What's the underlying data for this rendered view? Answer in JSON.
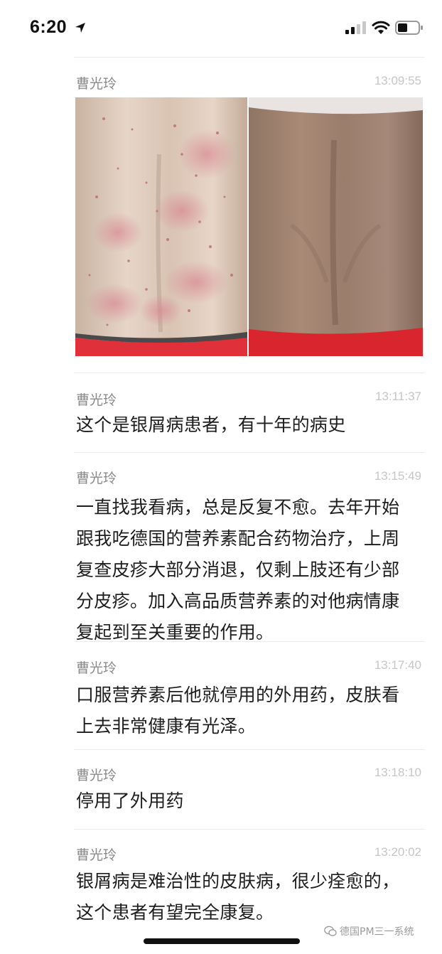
{
  "status_bar": {
    "time": "6:20"
  },
  "messages": [
    {
      "sender": "曹光玲",
      "time": "13:09:55",
      "type": "images"
    },
    {
      "sender": "曹光玲",
      "time": "13:11:37",
      "text": "这个是银屑病患者，有十年的病史"
    },
    {
      "sender": "曹光玲",
      "time": "13:15:49",
      "text": "一直找我看病，总是反复不愈。去年开始\n跟我吃德国的营养素配合药物治疗，上周\n复查皮疹大部分消退，仅剩上肢还有少部\n分皮疹。加入高品质营养素的对他病情康\n复起到至关重要的作用。"
    },
    {
      "sender": "曹光玲",
      "time": "13:17:40",
      "text": "口服营养素后他就停用的外用药，皮肤看\n上去非常健康有光泽。"
    },
    {
      "sender": "曹光玲",
      "time": "13:18:10",
      "text": "停用了外用药"
    },
    {
      "sender": "曹光玲",
      "time": "13:20:02",
      "text": "银屑病是难治性的皮肤病，很少痊愈的，\n这个患者有望完全康复。"
    }
  ],
  "watermark": {
    "text": "德国PM三一系统"
  }
}
